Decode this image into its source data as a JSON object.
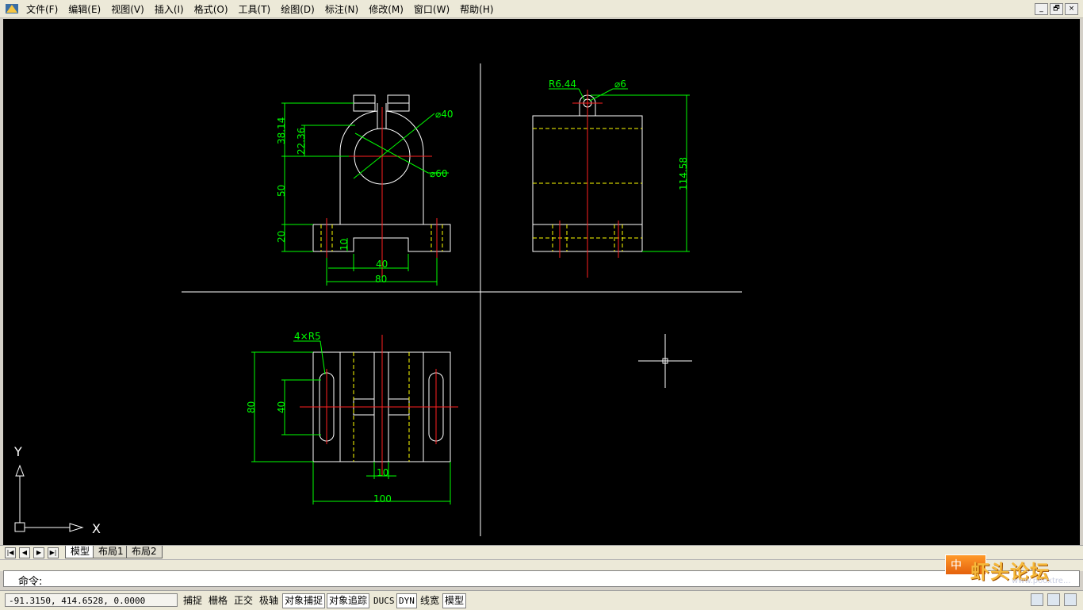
{
  "menubar": {
    "items": [
      "文件(F)",
      "编辑(E)",
      "视图(V)",
      "插入(I)",
      "格式(O)",
      "工具(T)",
      "绘图(D)",
      "标注(N)",
      "修改(M)",
      "窗口(W)",
      "帮助(H)"
    ],
    "window_controls": [
      "_",
      "🗗",
      "×"
    ]
  },
  "drawing": {
    "colors": {
      "background": "#000000",
      "geometry": "#ffffff",
      "dimensions": "#00ff00",
      "centerlines": "#ff2020",
      "hidden": "#ffff00"
    },
    "front_view": {
      "dims": [
        "38.14",
        "22.36",
        "50",
        "20",
        "10",
        "40",
        "80"
      ],
      "leaders": [
        "⌀40",
        "⌀60"
      ]
    },
    "side_view": {
      "dims": [
        "114.58"
      ],
      "leaders": [
        "R6.44",
        "⌀6"
      ]
    },
    "top_view": {
      "dims": [
        "80",
        "40",
        "10",
        "100"
      ],
      "leaders": [
        "4×R5"
      ]
    },
    "ucs": {
      "x_label": "X",
      "y_label": "Y"
    }
  },
  "tabs": {
    "nav": [
      "|◀",
      "◀",
      "▶",
      "▶|"
    ],
    "items": [
      "模型",
      "布局1",
      "布局2"
    ],
    "active": "模型"
  },
  "command": {
    "prompt": "命令:"
  },
  "status": {
    "coords": "-91.3150,  414.6528, 0.0000",
    "buttons": [
      "捕捉",
      "栅格",
      "正交",
      "极轴",
      "对象捕捉",
      "对象追踪",
      "DUCS",
      "DYN",
      "线宽",
      "模型"
    ]
  },
  "watermark": {
    "badge": "中",
    "text": "虾头论坛",
    "url": "www.pooxtre..."
  }
}
